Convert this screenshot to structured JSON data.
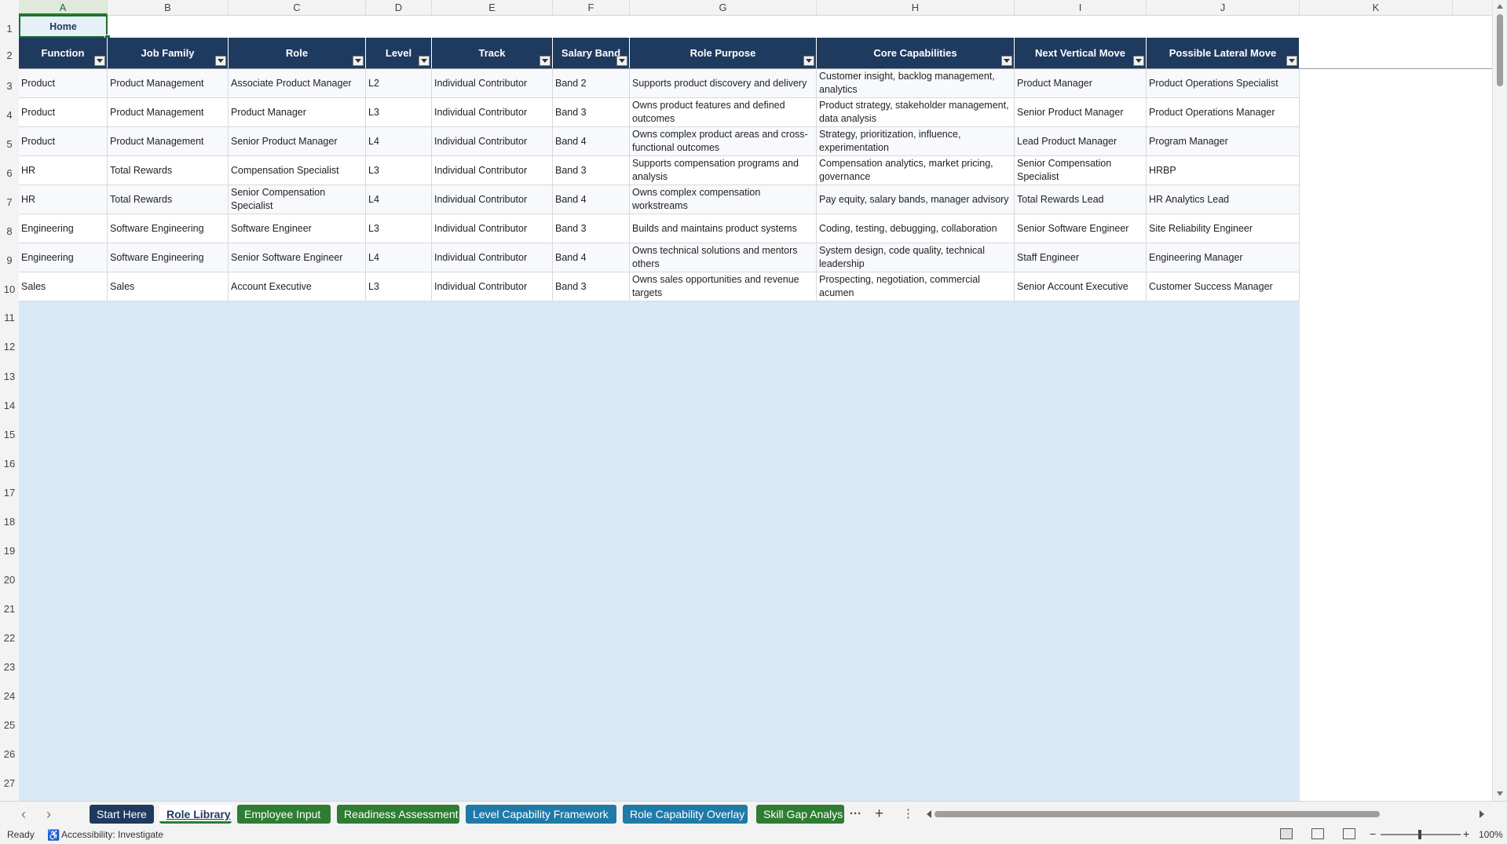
{
  "grid": {
    "columns": [
      "A",
      "B",
      "C",
      "D",
      "E",
      "F",
      "G",
      "H",
      "I",
      "J",
      "K"
    ],
    "rows": [
      "1",
      "2",
      "3",
      "4",
      "5",
      "6",
      "7",
      "8",
      "9",
      "10",
      "11",
      "12",
      "13",
      "14",
      "15",
      "16",
      "17",
      "18",
      "19",
      "20",
      "21",
      "22",
      "23",
      "24",
      "25",
      "26",
      "27"
    ],
    "selected_column": "A"
  },
  "home_cell": "Home",
  "table": {
    "headers": [
      "Function",
      "Job Family",
      "Role",
      "Level",
      "Track",
      "Salary Band",
      "Role Purpose",
      "Core Capabilities",
      "Next Vertical Move",
      "Possible Lateral Move"
    ],
    "rows": [
      [
        "Product",
        "Product Management",
        "Associate Product Manager",
        "L2",
        "Individual Contributor",
        "Band 2",
        "Supports product discovery and delivery",
        "Customer insight, backlog management, analytics",
        "Product Manager",
        "Product Operations Specialist"
      ],
      [
        "Product",
        "Product Management",
        "Product Manager",
        "L3",
        "Individual Contributor",
        "Band 3",
        "Owns product features and defined outcomes",
        "Product strategy, stakeholder management, data analysis",
        "Senior Product Manager",
        "Product Operations Manager"
      ],
      [
        "Product",
        "Product Management",
        "Senior Product Manager",
        "L4",
        "Individual Contributor",
        "Band 4",
        "Owns complex product areas and cross-functional outcomes",
        "Strategy, prioritization, influence, experimentation",
        "Lead Product Manager",
        "Program Manager"
      ],
      [
        "HR",
        "Total Rewards",
        "Compensation Specialist",
        "L3",
        "Individual Contributor",
        "Band 3",
        "Supports compensation programs and analysis",
        "Compensation analytics, market pricing, governance",
        "Senior Compensation Specialist",
        "HRBP"
      ],
      [
        "HR",
        "Total Rewards",
        "Senior Compensation Specialist",
        "L4",
        "Individual Contributor",
        "Band 4",
        "Owns complex compensation workstreams",
        "Pay equity, salary bands, manager advisory",
        "Total Rewards Lead",
        "HR Analytics Lead"
      ],
      [
        "Engineering",
        "Software Engineering",
        "Software Engineer",
        "L3",
        "Individual Contributor",
        "Band 3",
        "Builds and maintains product systems",
        "Coding, testing, debugging, collaboration",
        "Senior Software Engineer",
        "Site Reliability Engineer"
      ],
      [
        "Engineering",
        "Software Engineering",
        "Senior Software Engineer",
        "L4",
        "Individual Contributor",
        "Band 4",
        "Owns technical solutions and mentors others",
        "System design, code quality, technical leadership",
        "Staff Engineer",
        "Engineering Manager"
      ],
      [
        "Sales",
        "Sales",
        "Account Executive",
        "L3",
        "Individual Contributor",
        "Band 3",
        "Owns sales opportunities and revenue targets",
        "Prospecting, negotiation, commercial acumen",
        "Senior Account Executive",
        "Customer Success Manager"
      ]
    ]
  },
  "tabs": [
    {
      "label": "Start Here",
      "color": "#1f3a5f"
    },
    {
      "label": "Role Library",
      "color": "#ffffff",
      "active": true
    },
    {
      "label": "Employee Input",
      "color": "#2e7d32"
    },
    {
      "label": "Readiness Assessment",
      "color": "#2e7d32"
    },
    {
      "label": "Level Capability Framework",
      "color": "#1f7aa8"
    },
    {
      "label": "Role Capability Overlay",
      "color": "#1f7aa8"
    },
    {
      "label": "Skill Gap Analys",
      "color": "#2e7d32"
    }
  ],
  "tabbar": {
    "more": "···",
    "add": "+",
    "options": "⋮"
  },
  "status": {
    "ready": "Ready",
    "accessibility": "Accessibility: Investigate",
    "zoom": "100%",
    "zoom_minus": "−",
    "zoom_plus": "+"
  }
}
